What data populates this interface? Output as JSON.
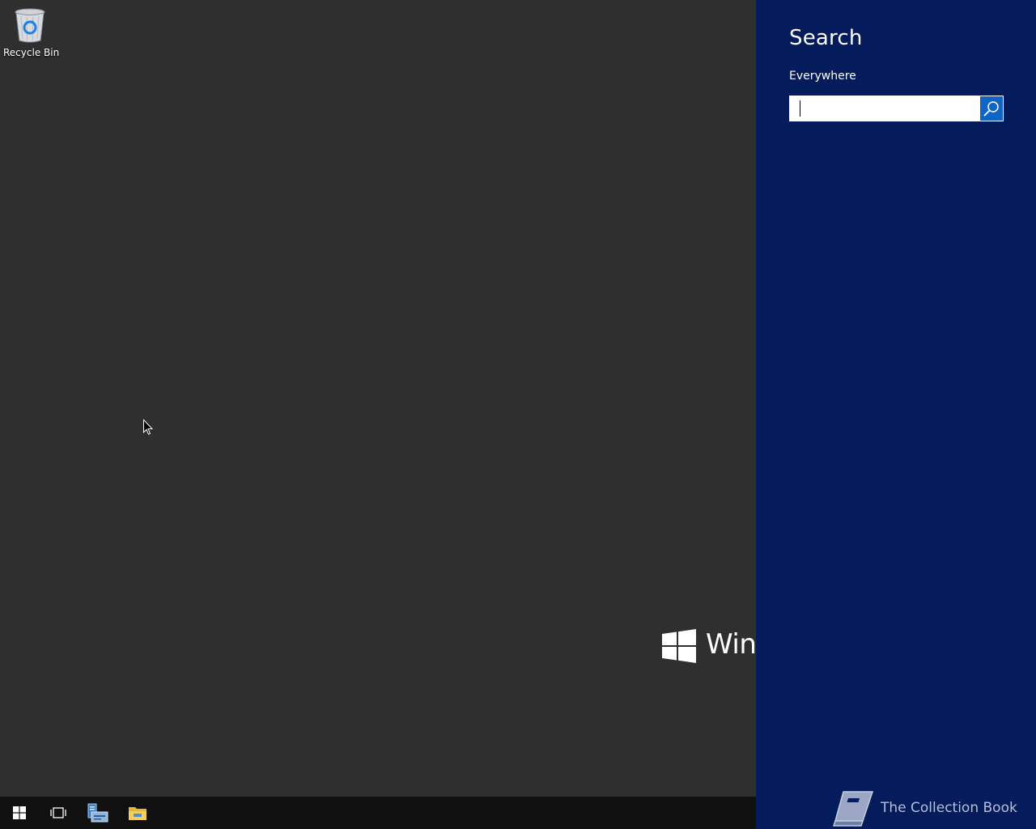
{
  "desktop": {
    "icons": [
      {
        "label": "Recycle Bin",
        "icon": "recycle-bin-icon"
      }
    ],
    "watermark": {
      "text": "Winc",
      "icon": "windows-logo-icon"
    }
  },
  "taskbar": {
    "buttons": [
      {
        "name": "start-button",
        "icon": "windows-start-icon"
      },
      {
        "name": "task-view-button",
        "icon": "task-view-icon"
      },
      {
        "name": "server-manager-button",
        "icon": "server-manager-icon"
      },
      {
        "name": "file-explorer-button",
        "icon": "folder-icon"
      }
    ]
  },
  "charm": {
    "title": "Search",
    "scope": "Everywhere",
    "search": {
      "value": "",
      "placeholder": ""
    },
    "brand": {
      "text": "The Collection Book",
      "icon": "book-icon"
    }
  },
  "colors": {
    "desktop_bg": "#2f2f2f",
    "taskbar_bg": "#101010",
    "charm_bg": "#041c5c",
    "search_button_bg": "#0f64c4"
  }
}
